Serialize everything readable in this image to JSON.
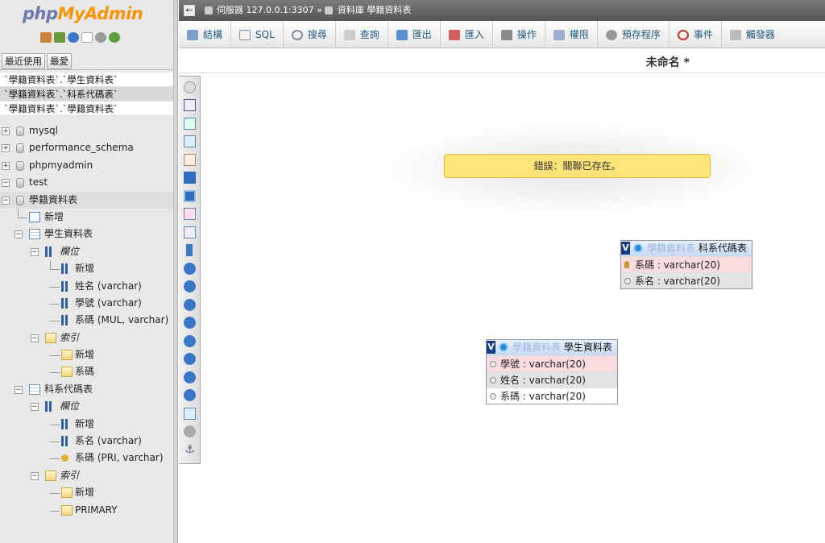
{
  "logo": {
    "part1": "php",
    "part2": "MyAdmin"
  },
  "nav": {
    "tabs": [
      "最近使用",
      "最愛"
    ],
    "recent": [
      "`學籍資料表`.`學生資料表`",
      "`學籍資料表`.`科系代碼表`",
      "`學籍資料表`.`學籍資料表`"
    ],
    "databases": [
      "mysql",
      "performance_schema",
      "phpmyadmin",
      "test",
      "學籍資料表"
    ],
    "tree": {
      "new": "新增",
      "table1": "學生資料表",
      "table1_cols_label": "欄位",
      "table1_cols": [
        "新增",
        "姓名 (varchar)",
        "學號 (varchar)",
        "系碼 (MUL, varchar)"
      ],
      "table1_idx_label": "索引",
      "table1_idx": [
        "新增",
        "系碼"
      ],
      "table2": "科系代碼表",
      "table2_cols_label": "欄位",
      "table2_cols": [
        "新增",
        "系名 (varchar)",
        "系碼 (PRI, varchar)"
      ],
      "table2_idx_label": "索引",
      "table2_idx": [
        "新增",
        "PRIMARY"
      ]
    }
  },
  "breadcrumb": {
    "server_label": "伺服器",
    "server": "127.0.0.1:3307",
    "sep": "»",
    "db_label": "資料庫",
    "db": "學籍資料表"
  },
  "menu": [
    "結構",
    "SQL",
    "搜尋",
    "查詢",
    "匯出",
    "匯入",
    "操作",
    "權限",
    "預存程序",
    "事件",
    "觸發器"
  ],
  "title": "未命名 *",
  "error": "錯誤：關聯已存在。",
  "designer": {
    "table_a": {
      "v": "V",
      "db": "學籍資料表",
      "name": "科系代碼表",
      "rows": [
        "系碼 : varchar(20)",
        "系名 : varchar(20)"
      ]
    },
    "table_b": {
      "v": "V",
      "db": "學籍資料表",
      "name": "學生資料表",
      "rows": [
        "學號 : varchar(20)",
        "姓名 : varchar(20)",
        "系碼 : varchar(20)"
      ]
    }
  }
}
